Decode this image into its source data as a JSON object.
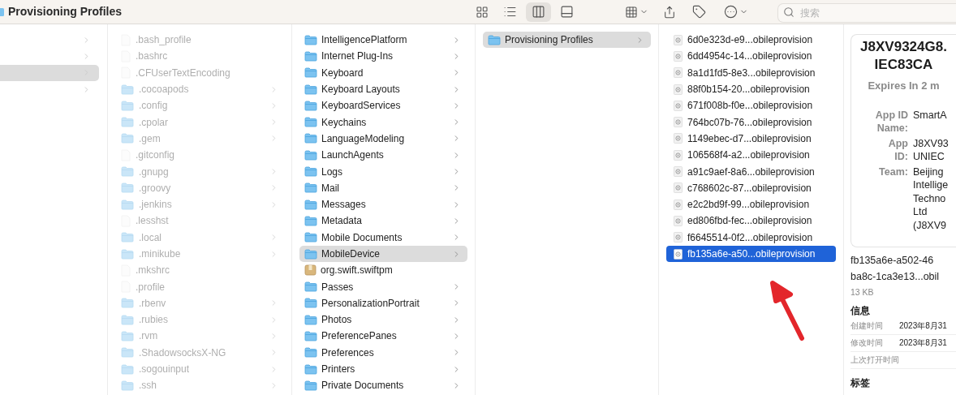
{
  "window": {
    "title": "Provisioning Profiles"
  },
  "toolbar": {
    "view_modes": [
      {
        "kind": "icons",
        "selected": false
      },
      {
        "kind": "list",
        "selected": false
      },
      {
        "kind": "columns",
        "selected": true
      },
      {
        "kind": "gallery",
        "selected": false
      }
    ],
    "search": {
      "placeholder": "搜索"
    }
  },
  "column_1": {
    "items": [
      {
        "selected": false
      },
      {
        "selected": false
      },
      {
        "selected": true
      },
      {
        "selected": false
      }
    ]
  },
  "column_2": {
    "items": [
      {
        "name": ".bash_profile",
        "kind": "file",
        "hidden": true
      },
      {
        "name": ".bashrc",
        "kind": "file",
        "hidden": true
      },
      {
        "name": ".CFUserTextEncoding",
        "kind": "file",
        "hidden": true
      },
      {
        "name": ".cocoapods",
        "kind": "folder",
        "hidden": true
      },
      {
        "name": ".config",
        "kind": "folder",
        "hidden": true
      },
      {
        "name": ".cpolar",
        "kind": "folder",
        "hidden": true
      },
      {
        "name": ".gem",
        "kind": "folder",
        "hidden": true
      },
      {
        "name": ".gitconfig",
        "kind": "file",
        "hidden": true
      },
      {
        "name": ".gnupg",
        "kind": "folder",
        "hidden": true
      },
      {
        "name": ".groovy",
        "kind": "folder",
        "hidden": true
      },
      {
        "name": ".jenkins",
        "kind": "folder",
        "hidden": true
      },
      {
        "name": ".lesshst",
        "kind": "file",
        "hidden": true
      },
      {
        "name": ".local",
        "kind": "folder",
        "hidden": true
      },
      {
        "name": ".minikube",
        "kind": "folder",
        "hidden": true
      },
      {
        "name": ".mkshrc",
        "kind": "file",
        "hidden": true
      },
      {
        "name": ".profile",
        "kind": "file",
        "hidden": true
      },
      {
        "name": ".rbenv",
        "kind": "folder",
        "hidden": true
      },
      {
        "name": ".rubies",
        "kind": "folder",
        "hidden": true
      },
      {
        "name": ".rvm",
        "kind": "folder",
        "hidden": true
      },
      {
        "name": ".ShadowsocksX-NG",
        "kind": "folder",
        "hidden": true
      },
      {
        "name": ".sogouinput",
        "kind": "folder",
        "hidden": true
      },
      {
        "name": ".ssh",
        "kind": "folder",
        "hidden": true
      }
    ]
  },
  "column_3": {
    "items": [
      {
        "name": "IntelligencePlatform",
        "kind": "folder",
        "selected": false
      },
      {
        "name": "Internet Plug-Ins",
        "kind": "folder",
        "selected": false
      },
      {
        "name": "Keyboard",
        "kind": "folder",
        "selected": false
      },
      {
        "name": "Keyboard Layouts",
        "kind": "folder",
        "selected": false
      },
      {
        "name": "KeyboardServices",
        "kind": "folder",
        "selected": false
      },
      {
        "name": "Keychains",
        "kind": "folder",
        "selected": false
      },
      {
        "name": "LanguageModeling",
        "kind": "folder",
        "selected": false
      },
      {
        "name": "LaunchAgents",
        "kind": "folder",
        "selected": false
      },
      {
        "name": "Logs",
        "kind": "folder",
        "selected": false
      },
      {
        "name": "Mail",
        "kind": "folder",
        "selected": false
      },
      {
        "name": "Messages",
        "kind": "folder",
        "selected": false
      },
      {
        "name": "Metadata",
        "kind": "folder",
        "selected": false
      },
      {
        "name": "Mobile Documents",
        "kind": "folder",
        "selected": false
      },
      {
        "name": "MobileDevice",
        "kind": "folder",
        "selected": true
      },
      {
        "name": "org.swift.swiftpm",
        "kind": "package",
        "selected": false
      },
      {
        "name": "Passes",
        "kind": "folder",
        "selected": false
      },
      {
        "name": "PersonalizationPortrait",
        "kind": "folder",
        "selected": false
      },
      {
        "name": "Photos",
        "kind": "folder",
        "selected": false
      },
      {
        "name": "PreferencePanes",
        "kind": "folder",
        "selected": false
      },
      {
        "name": "Preferences",
        "kind": "folder",
        "selected": false
      },
      {
        "name": "Printers",
        "kind": "folder",
        "selected": false
      },
      {
        "name": "Private Documents",
        "kind": "folder",
        "selected": false
      }
    ]
  },
  "column_4": {
    "items": [
      {
        "name": "Provisioning Profiles",
        "kind": "folder",
        "selected": true
      }
    ]
  },
  "column_5": {
    "items": [
      {
        "name": "6d0e323d-e9...obileprovision",
        "kind": "profile",
        "selected": false
      },
      {
        "name": "6dd4954c-14...obileprovision",
        "kind": "profile",
        "selected": false
      },
      {
        "name": "8a1d1fd5-8e3...obileprovision",
        "kind": "profile",
        "selected": false
      },
      {
        "name": "88f0b154-20...obileprovision",
        "kind": "profile",
        "selected": false
      },
      {
        "name": "671f008b-f0e...obileprovision",
        "kind": "profile",
        "selected": false
      },
      {
        "name": "764bc07b-76...obileprovision",
        "kind": "profile",
        "selected": false
      },
      {
        "name": "1149ebec-d7...obileprovision",
        "kind": "profile",
        "selected": false
      },
      {
        "name": "106568f4-a2...obileprovision",
        "kind": "profile",
        "selected": false
      },
      {
        "name": "a91c9aef-8a6...obileprovision",
        "kind": "profile",
        "selected": false
      },
      {
        "name": "c768602c-87...obileprovision",
        "kind": "profile",
        "selected": false
      },
      {
        "name": "e2c2bd9f-99...obileprovision",
        "kind": "profile",
        "selected": false
      },
      {
        "name": "ed806fbd-fec...obileprovision",
        "kind": "profile",
        "selected": false
      },
      {
        "name": "f6645514-0f2...obileprovision",
        "kind": "profile",
        "selected": false
      },
      {
        "name": "fb135a6e-a50...obileprovision",
        "kind": "profile",
        "selected": true
      }
    ]
  },
  "preview": {
    "title_lines": [
      "J8XV9324G8.",
      "IEC83CA"
    ],
    "subtitle": "Expires In 2 m",
    "fields": [
      {
        "label_lines": [
          "App ID",
          "Name:"
        ],
        "value_lines": [
          "SmartA"
        ]
      },
      {
        "label_lines": [
          "App",
          "ID:"
        ],
        "value_lines": [
          "J8XV93",
          "UNIEC"
        ]
      },
      {
        "label_lines": [
          "Team:"
        ],
        "value_lines": [
          "Beijing",
          "Intellige",
          "Techno",
          "Ltd",
          "(J8XV9"
        ]
      }
    ],
    "file_name_lines": [
      "fb135a6e-a502-46",
      "ba8c-1ca3e13...obil"
    ],
    "size": "13 KB",
    "info_heading": "信息",
    "info_rows": [
      {
        "label": "创建时间",
        "value": "2023年8月31"
      },
      {
        "label": "修改时间",
        "value": "2023年8月31"
      },
      {
        "label": "上次打开时间"
      }
    ],
    "tags_heading": "标签"
  }
}
